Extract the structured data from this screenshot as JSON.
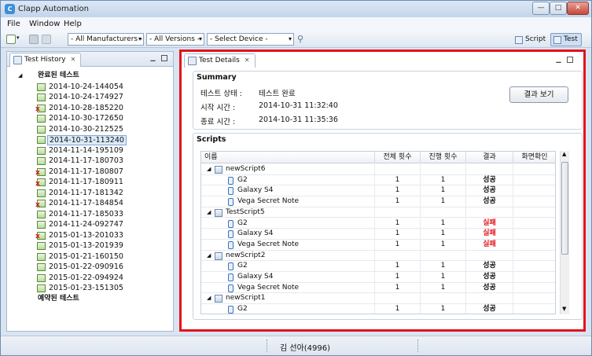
{
  "window": {
    "title": "Clapp Automation",
    "controls": {
      "min": "—",
      "max": "□",
      "close": "✕"
    }
  },
  "menu": [
    "File",
    "Window",
    "Help"
  ],
  "toolbar": {
    "manufacturers": "- All Manufacturers -",
    "versions": "- All Versions -",
    "device": "- Select Device -",
    "script_label": "Script",
    "test_label": "Test",
    "active_perspective": "Test"
  },
  "history": {
    "tab_title": "Test History",
    "completed_group": "완료된 테스트",
    "reserved_group": "예약된 테스트",
    "selected": "2014-10-31-113240",
    "items": [
      {
        "label": "2014-10-24-144054",
        "status": "pass"
      },
      {
        "label": "2014-10-24-174927",
        "status": "pass"
      },
      {
        "label": "2014-10-28-185220",
        "status": "fail"
      },
      {
        "label": "2014-10-30-172650",
        "status": "pass"
      },
      {
        "label": "2014-10-30-212525",
        "status": "pass"
      },
      {
        "label": "2014-10-31-113240",
        "status": "pass"
      },
      {
        "label": "2014-11-14-195109",
        "status": "pass"
      },
      {
        "label": "2014-11-17-180703",
        "status": "pass"
      },
      {
        "label": "2014-11-17-180807",
        "status": "fail"
      },
      {
        "label": "2014-11-17-180911",
        "status": "fail"
      },
      {
        "label": "2014-11-17-181342",
        "status": "pass"
      },
      {
        "label": "2014-11-17-184854",
        "status": "fail"
      },
      {
        "label": "2014-11-17-185033",
        "status": "pass"
      },
      {
        "label": "2014-11-24-092747",
        "status": "pass"
      },
      {
        "label": "2015-01-13-201033",
        "status": "fail"
      },
      {
        "label": "2015-01-13-201939",
        "status": "pass"
      },
      {
        "label": "2015-01-21-160150",
        "status": "pass"
      },
      {
        "label": "2015-01-22-090916",
        "status": "pass"
      },
      {
        "label": "2015-01-22-094924",
        "status": "pass"
      },
      {
        "label": "2015-01-23-151305",
        "status": "pass"
      }
    ]
  },
  "details": {
    "tab_title": "Test Details",
    "summary": {
      "title": "Summary",
      "status_label": "테스트 상태 :",
      "status_value": "테스트 완료",
      "start_label": "시작 시간 :",
      "start_value": "2014-10-31 11:32:40",
      "end_label": "종료 시간 :",
      "end_value": "2014-10-31 11:35:36",
      "result_button": "결과 보기"
    },
    "scripts": {
      "title": "Scripts",
      "columns": [
        "이름",
        "전체 횟수",
        "진행 횟수",
        "결과",
        "화면확인"
      ],
      "rows": [
        {
          "type": "script",
          "name": "newScript6"
        },
        {
          "type": "device",
          "name": "G2",
          "total": "1",
          "done": "1",
          "result": "성공",
          "status": "ok"
        },
        {
          "type": "device",
          "name": "Galaxy S4",
          "total": "1",
          "done": "1",
          "result": "성공",
          "status": "ok"
        },
        {
          "type": "device",
          "name": "Vega Secret Note",
          "total": "1",
          "done": "1",
          "result": "성공",
          "status": "ok"
        },
        {
          "type": "script",
          "name": "TestScript5"
        },
        {
          "type": "device",
          "name": "G2",
          "total": "1",
          "done": "1",
          "result": "실패",
          "status": "fail"
        },
        {
          "type": "device",
          "name": "Galaxy S4",
          "total": "1",
          "done": "1",
          "result": "실패",
          "status": "fail"
        },
        {
          "type": "device",
          "name": "Vega Secret Note",
          "total": "1",
          "done": "1",
          "result": "실패",
          "status": "fail"
        },
        {
          "type": "script",
          "name": "newScript2"
        },
        {
          "type": "device",
          "name": "G2",
          "total": "1",
          "done": "1",
          "result": "성공",
          "status": "ok"
        },
        {
          "type": "device",
          "name": "Galaxy S4",
          "total": "1",
          "done": "1",
          "result": "성공",
          "status": "ok"
        },
        {
          "type": "device",
          "name": "Vega Secret Note",
          "total": "1",
          "done": "1",
          "result": "성공",
          "status": "ok"
        },
        {
          "type": "script",
          "name": "newScript1"
        },
        {
          "type": "device",
          "name": "G2",
          "total": "1",
          "done": "1",
          "result": "성공",
          "status": "ok"
        }
      ]
    }
  },
  "status": {
    "user": "김 선아(4996)"
  },
  "colors": {
    "highlight_border": "#e3131b",
    "fail": "#e3131b"
  }
}
